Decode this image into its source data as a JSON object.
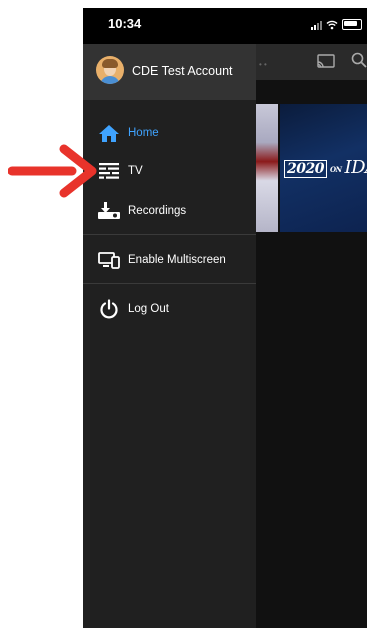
{
  "status_bar": {
    "time": "10:34"
  },
  "account": {
    "name": "CDE Test Account"
  },
  "menu": {
    "items": [
      {
        "label": "Home",
        "icon": "home-icon",
        "active": true
      },
      {
        "label": "TV",
        "icon": "tv-guide-icon",
        "active": false
      },
      {
        "label": "Recordings",
        "icon": "recordings-icon",
        "active": false
      },
      {
        "label": "Enable Multiscreen",
        "icon": "multiscreen-icon",
        "active": false
      },
      {
        "label": "Log Out",
        "icon": "power-icon",
        "active": false
      }
    ]
  },
  "background": {
    "thumbnail_text": {
      "year": "2020",
      "on": "ON",
      "name": "IDA"
    }
  },
  "colors": {
    "accent": "#3fa3ff",
    "drawer": "#202020",
    "header": "#333333",
    "annotation_arrow": "#e8332b"
  }
}
